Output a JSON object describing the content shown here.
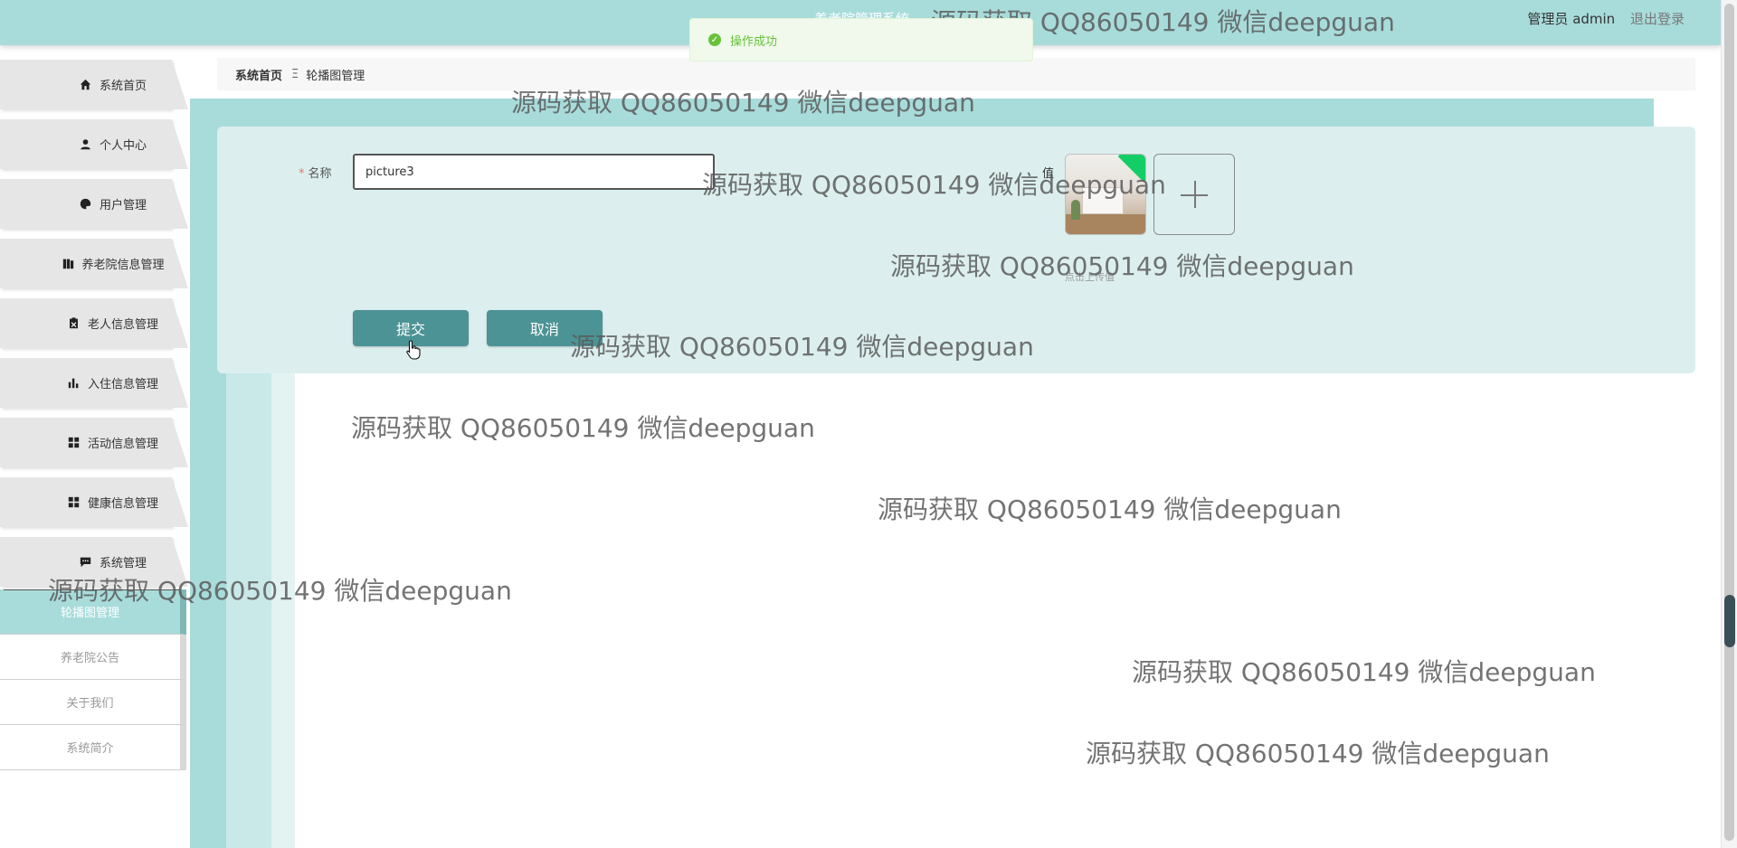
{
  "header": {
    "app_title": "养老院管理系统",
    "admin_label": "管理员 admin",
    "logout": "退出登录"
  },
  "toast": {
    "message": "操作成功"
  },
  "breadcrumb": {
    "home": "系统首页",
    "separator": "Ξ",
    "current": "轮播图管理"
  },
  "sidebar": {
    "items": [
      {
        "label": "系统首页",
        "icon": "home-icon"
      },
      {
        "label": "个人中心",
        "icon": "user-icon"
      },
      {
        "label": "用户管理",
        "icon": "palette-icon"
      },
      {
        "label": "养老院信息管理",
        "icon": "book-icon"
      },
      {
        "label": "老人信息管理",
        "icon": "clipboard-icon"
      },
      {
        "label": "入住信息管理",
        "icon": "bar-chart-icon"
      },
      {
        "label": "活动信息管理",
        "icon": "grid-icon"
      },
      {
        "label": "健康信息管理",
        "icon": "grid-icon"
      },
      {
        "label": "系统管理",
        "icon": "chat-icon"
      }
    ],
    "submenu": [
      {
        "label": "轮播图管理",
        "active": true
      },
      {
        "label": "养老院公告",
        "active": false
      },
      {
        "label": "关于我们",
        "active": false
      },
      {
        "label": "系统简介",
        "active": false
      }
    ]
  },
  "form": {
    "name_label": "名称",
    "required_mark": "*",
    "name_value": "picture3",
    "value_label": "值",
    "upload_hint": "点击上传值",
    "submit": "提交",
    "cancel": "取消"
  },
  "watermarks": [
    "源码获取 QQ86050149 微信deepguan",
    "源码获取 QQ86050149 微信deepguan",
    "源码获取 QQ86050149 微信deepguan",
    "源码获取 QQ86050149 微信deepguan",
    "源码获取 QQ86050149 微信deepguan",
    "源码获取 QQ86050149 微信deepguan",
    "源码获取 QQ86050149 微信deepguan",
    "源码获取 QQ86050149 微信deepguan",
    "源码获取 QQ86050149 微信deepguan",
    "源码获取 QQ86050149 微信deepguan"
  ],
  "colors": {
    "accent": "#a8dcdb",
    "button": "#4c9396",
    "card": "#dcefee",
    "success": "#67c23a"
  }
}
